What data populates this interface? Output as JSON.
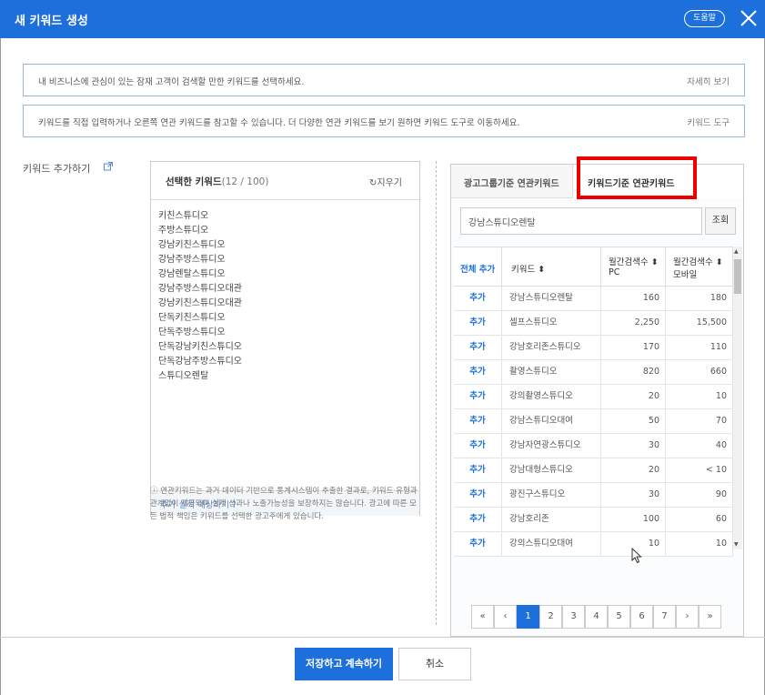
{
  "dialog": {
    "title": "새 키워드 생성",
    "help_label": "도움말"
  },
  "info1": {
    "message": "내 비즈니스에 관심이 있는 잠재 고객이 검색할 만한 키워드를 선택하세요.",
    "link": "자세히 보기"
  },
  "info2": {
    "message": "키워드를 직접 입력하거나 오른쪽 연관 키워드를 참고할 수 있습니다. 더 다양한 연관 키워드를 보기 원하면 키워드 도구로 이동하세요.",
    "link": "키워드 도구"
  },
  "keyword_add": {
    "label": "키워드 추가하기"
  },
  "selected": {
    "title": "선택한 키워드",
    "count": "(12 / 100)",
    "clear_label": "지우기",
    "keywords": [
      "키친스튜디오",
      "주방스튜디오",
      "강남키친스튜디오",
      "강남주방스튜디오",
      "강남렌탈스튜디오",
      "강남주방스튜디오대관",
      "강남키친스튜디오대관",
      "단독키친스튜디오",
      "단독주방스튜디오",
      "단독강남키친스튜디오",
      "단독강남주방스튜디오",
      "스튜디오렌탈"
    ],
    "footer": "추가 실적 예상하기"
  },
  "notice": "연관키워드는 과거 데이터 기반으로 통계시스템이 추출한 결과로, 키워드 유형과 관계없이 제공되며 실제 성과나 노출가능성을 보장하지는 않습니다. 광고에 따른 모든 법적 책임은 키워드를 선택한 광고주에게 있습니다.",
  "related": {
    "tabs": [
      "광고그룹기준 연관키워드",
      "키워드기준 연관키워드"
    ],
    "search_value": "강남스튜디오렌탈",
    "search_button": "조회",
    "columns": {
      "add_all": "전체 추가",
      "keyword": "키워드 ⬍",
      "pc": "월간검색수 ⬍",
      "pc_sub": "PC",
      "mobile": "월간검색수 ⬍",
      "mobile_sub": "모바일"
    },
    "rows": [
      {
        "add": "추가",
        "keyword": "강남스튜디오렌탈",
        "pc": "160",
        "mobile": "180"
      },
      {
        "add": "추가",
        "keyword": "셀프스튜디오",
        "pc": "2,250",
        "mobile": "15,500"
      },
      {
        "add": "추가",
        "keyword": "강남호리존스튜디오",
        "pc": "170",
        "mobile": "110"
      },
      {
        "add": "추가",
        "keyword": "촬영스튜디오",
        "pc": "820",
        "mobile": "660"
      },
      {
        "add": "추가",
        "keyword": "강의촬영스튜디오",
        "pc": "20",
        "mobile": "10"
      },
      {
        "add": "추가",
        "keyword": "강남스튜디오대여",
        "pc": "50",
        "mobile": "70"
      },
      {
        "add": "추가",
        "keyword": "강남자연광스튜디오",
        "pc": "30",
        "mobile": "40"
      },
      {
        "add": "추가",
        "keyword": "강남대형스튜디오",
        "pc": "20",
        "mobile": "< 10"
      },
      {
        "add": "추가",
        "keyword": "광진구스튜디오",
        "pc": "30",
        "mobile": "90"
      },
      {
        "add": "추가",
        "keyword": "강남호리존",
        "pc": "100",
        "mobile": "60"
      },
      {
        "add": "추가",
        "keyword": "강의스튜디오대여",
        "pc": "10",
        "mobile": "10"
      }
    ],
    "pagination": [
      "«",
      "‹",
      "1",
      "2",
      "3",
      "4",
      "5",
      "6",
      "7",
      "›",
      "»"
    ],
    "current_page": "1"
  },
  "footer": {
    "save_label": "저장하고 계속하기",
    "cancel_label": "취소"
  },
  "colors": {
    "primary": "#1d6fdc",
    "highlight": "#ee0000"
  }
}
